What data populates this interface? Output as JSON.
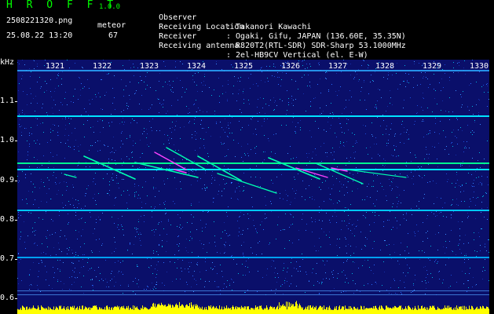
{
  "header": {
    "title": "H R O F F T",
    "version": "1.0.0",
    "filename": "2508221320.png",
    "datetime": "25.08.22 13:20",
    "meteor_label": "meteor",
    "meteor_count": "67",
    "info": [
      {
        "key": "Observer",
        "value": ": Takanori Kawachi"
      },
      {
        "key": "Receiving Location",
        "value": ": Ogaki, Gifu, JAPAN (136.60E, 35.35N)"
      },
      {
        "key": "Receiver",
        "value": ": R820T2(RTL-SDR) SDR-Sharp 53.1000MHz"
      },
      {
        "key": "Receiving antenna",
        "value": ": 2el-HB9CV Vertical (el. E-W)"
      }
    ]
  },
  "spectrogram": {
    "y_unit": "kHz",
    "y_ticks": [
      "1.1",
      "1.0",
      "0.9",
      "0.8",
      "0.7",
      "0.6"
    ],
    "x_ticks": [
      "1321",
      "1322",
      "1323",
      "1324",
      "1325",
      "1326",
      "1327",
      "1328",
      "1329",
      "1330"
    ],
    "colors": {
      "background": "#0a0f6a",
      "carrier": "#00e5ff",
      "echo": "#00ffb0",
      "echo_hot": "#ff40ff",
      "level": "#ffff00"
    }
  }
}
